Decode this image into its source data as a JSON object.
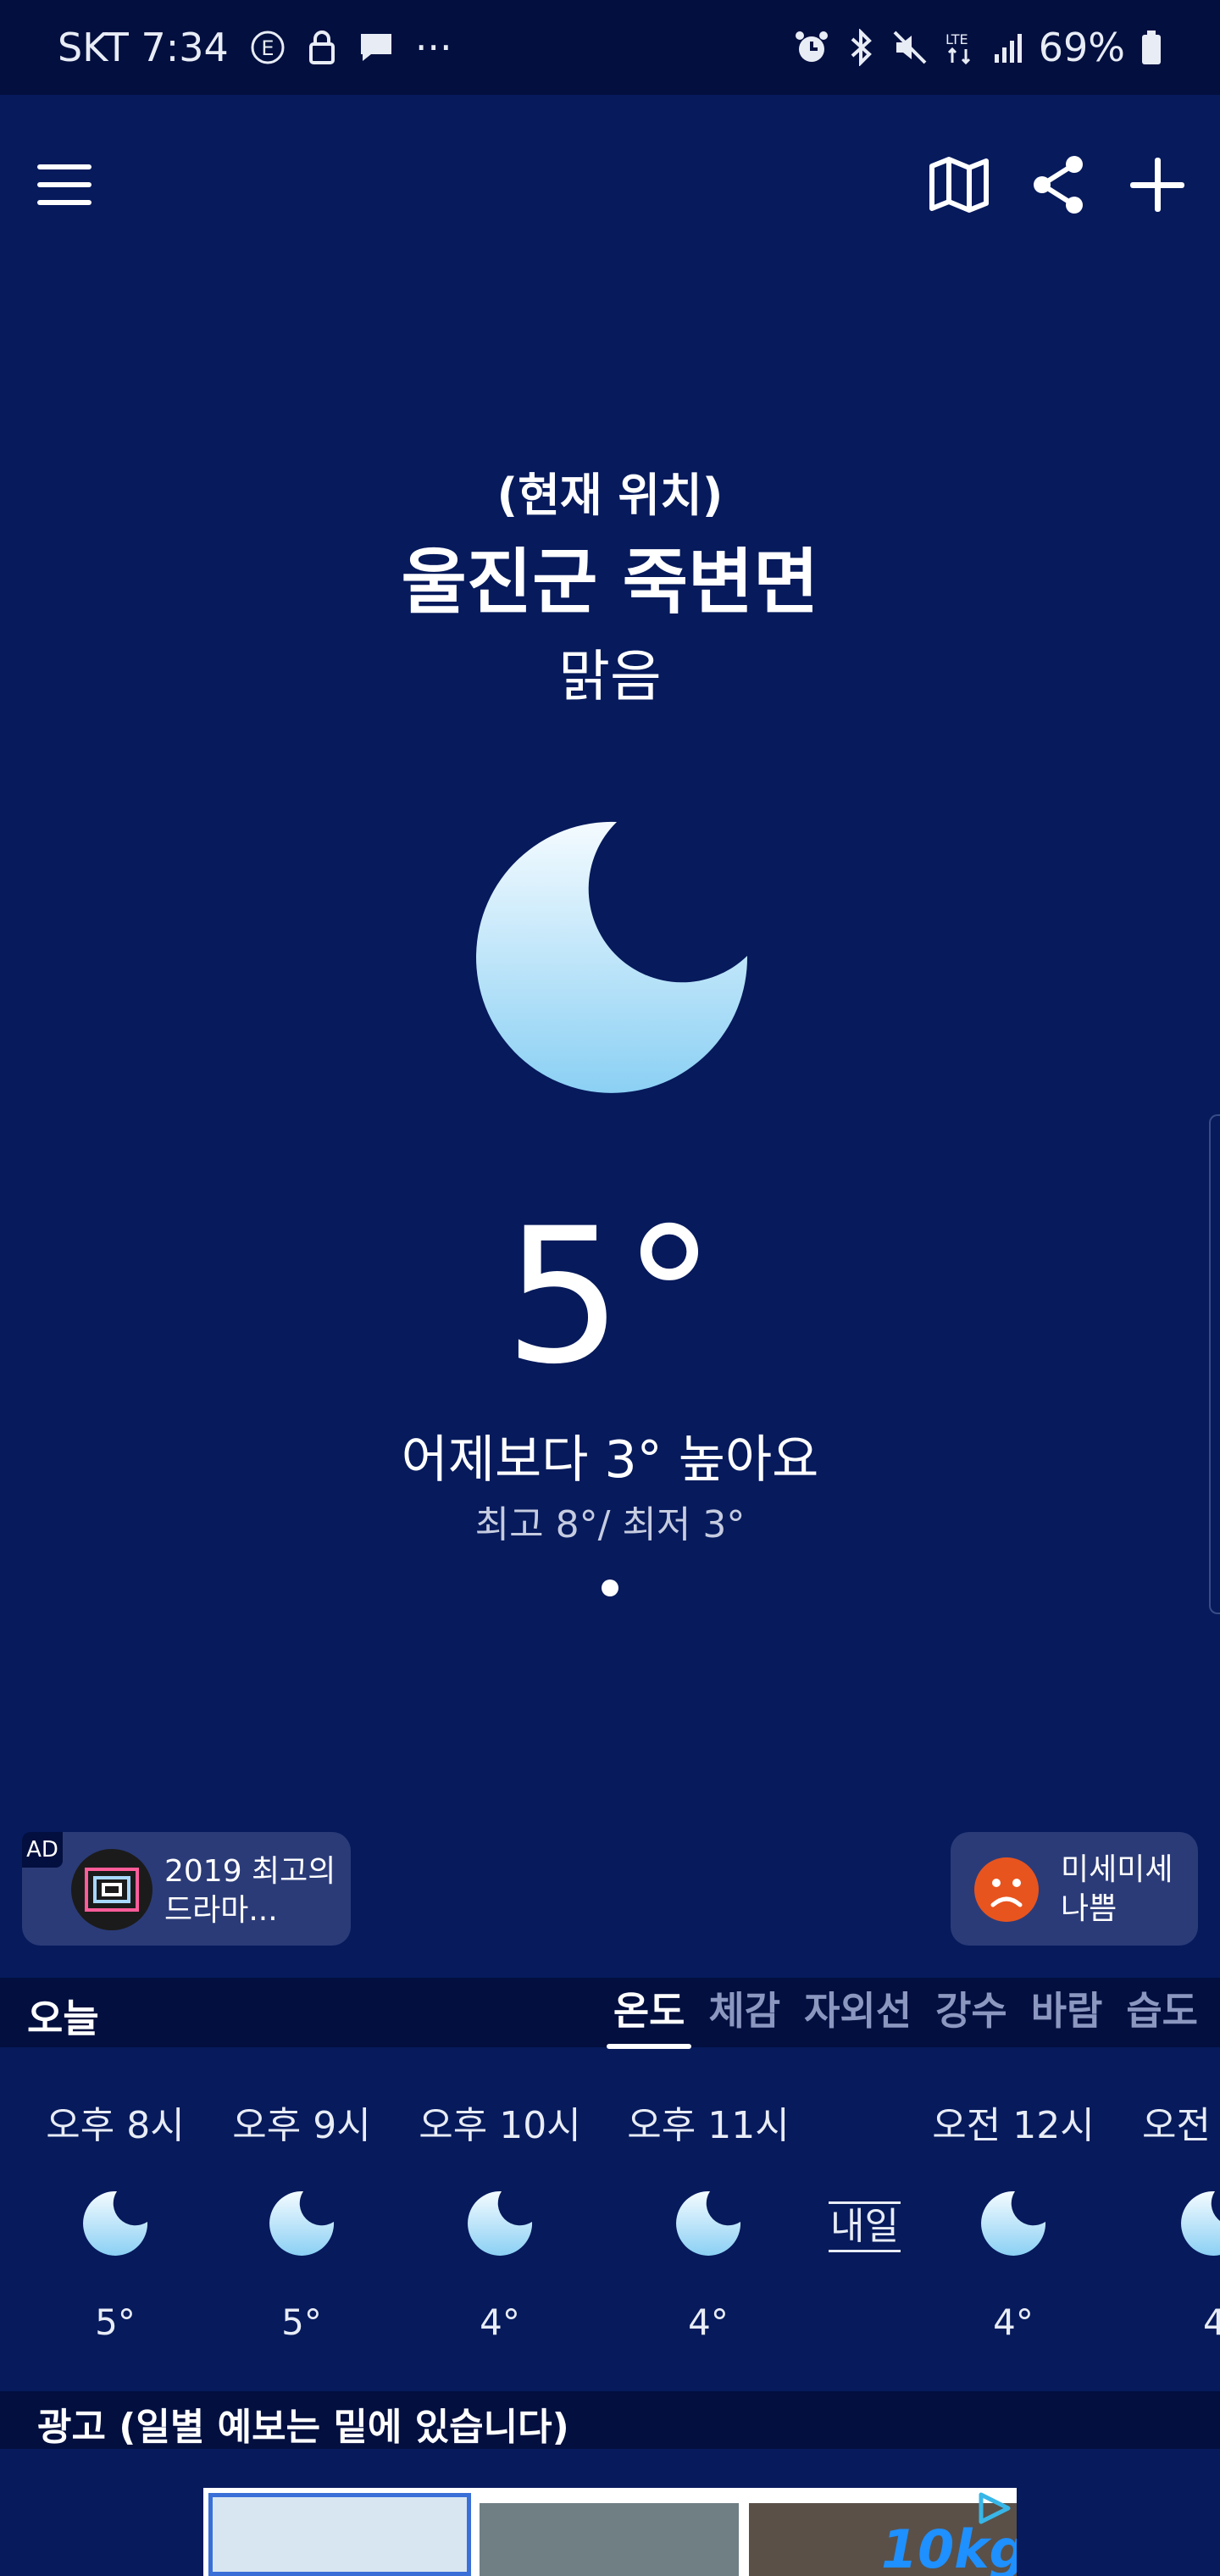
{
  "status_bar": {
    "carrier_time": "SKT 7:34",
    "battery": "69%",
    "more": "···"
  },
  "location": {
    "label": "(현재 위치)",
    "name": "울진군 죽변면"
  },
  "current": {
    "condition": "맑음",
    "temperature": "5°",
    "compare": "어제보다 3° 높아요",
    "hilo": "최고 8°/ 최저 3°",
    "icon": "moon-icon"
  },
  "ad_chip": {
    "label": "AD",
    "text_line1": "2019 최고의",
    "text_line2": "드라마..."
  },
  "dust_chip": {
    "line1": "미세미세",
    "line2": "나쁨",
    "face_color": "#e8541e"
  },
  "tab_bar": {
    "today": "오늘",
    "tabs": [
      "온도",
      "체감",
      "자외선",
      "강수",
      "바람",
      "습도"
    ],
    "active_index": 0
  },
  "hourly": [
    {
      "time": "오후 8시",
      "temp": "5°"
    },
    {
      "time": "오후 9시",
      "temp": "5°"
    },
    {
      "time": "오후 10시",
      "temp": "4°"
    },
    {
      "time": "오후 11시",
      "temp": "4°"
    },
    {
      "time": "오전 12시",
      "temp": "4°"
    },
    {
      "time": "오전",
      "temp": "4"
    }
  ],
  "tomorrow_label": "내일",
  "ad_section": {
    "label": "광고 (일별 예보는 밑에 있습니다)",
    "banner_text": "10kg"
  },
  "colors": {
    "background": "#061a5c",
    "status_bar": "#020f3f",
    "chip": "#2b3b78",
    "moon_top": "#f2fbff",
    "moon_bottom": "#8fd3f6"
  }
}
